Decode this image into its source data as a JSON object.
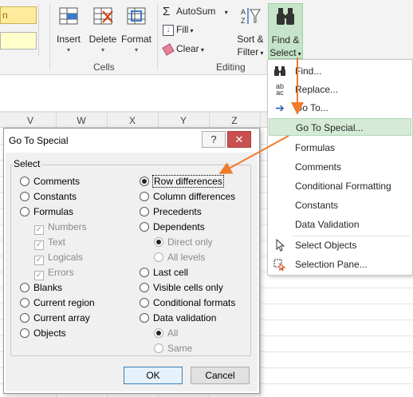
{
  "ribbon": {
    "cells_group": {
      "label": "Cells",
      "insert": "Insert",
      "delete": "Delete",
      "format": "Format"
    },
    "editing_group": {
      "label": "Editing",
      "autosum": "AutoSum",
      "fill": "Fill",
      "clear": "Clear",
      "sort_filter_1": "Sort &",
      "sort_filter_2": "Filter",
      "find_select_1": "Find &",
      "find_select_2": "Select"
    },
    "style_cell_text": "n"
  },
  "columns": [
    "V",
    "W",
    "X",
    "Y",
    "Z"
  ],
  "menu": {
    "items": [
      {
        "label": "Find...",
        "icon": "binoculars-icon"
      },
      {
        "label": "Replace...",
        "icon": "replace-icon"
      },
      {
        "label": "Go To...",
        "icon": "arrow-right-icon"
      },
      {
        "label": "Go To Special...",
        "icon": ""
      },
      {
        "label": "Formulas",
        "icon": ""
      },
      {
        "label": "Comments",
        "icon": ""
      },
      {
        "label": "Conditional Formatting",
        "icon": ""
      },
      {
        "label": "Constants",
        "icon": ""
      },
      {
        "label": "Data Validation",
        "icon": ""
      },
      {
        "label": "Select Objects",
        "icon": "pointer-icon"
      },
      {
        "label": "Selection Pane...",
        "icon": "selection-pane-icon"
      }
    ],
    "highlighted": "Go To Special..."
  },
  "dialog": {
    "title": "Go To Special",
    "help": "?",
    "close": "✕",
    "select_label": "Select",
    "left_options": [
      {
        "label": "Comments",
        "type": "radio",
        "checked": false,
        "enabled": true
      },
      {
        "label": "Constants",
        "type": "radio",
        "checked": false,
        "enabled": true
      },
      {
        "label": "Formulas",
        "type": "radio",
        "checked": false,
        "enabled": true
      },
      {
        "label": "Numbers",
        "type": "checkbox",
        "checked": true,
        "enabled": false
      },
      {
        "label": "Text",
        "type": "checkbox",
        "checked": true,
        "enabled": false
      },
      {
        "label": "Logicals",
        "type": "checkbox",
        "checked": true,
        "enabled": false
      },
      {
        "label": "Errors",
        "type": "checkbox",
        "checked": true,
        "enabled": false
      },
      {
        "label": "Blanks",
        "type": "radio",
        "checked": false,
        "enabled": true
      },
      {
        "label": "Current region",
        "type": "radio",
        "checked": false,
        "enabled": true
      },
      {
        "label": "Current array",
        "type": "radio",
        "checked": false,
        "enabled": true
      },
      {
        "label": "Objects",
        "type": "radio",
        "checked": false,
        "enabled": true
      }
    ],
    "right_options": [
      {
        "label": "Row differences",
        "type": "radio",
        "checked": true,
        "enabled": true
      },
      {
        "label": "Column differences",
        "type": "radio",
        "checked": false,
        "enabled": true
      },
      {
        "label": "Precedents",
        "type": "radio",
        "checked": false,
        "enabled": true
      },
      {
        "label": "Dependents",
        "type": "radio",
        "checked": false,
        "enabled": true
      },
      {
        "label": "Direct only",
        "type": "radio",
        "checked": true,
        "enabled": false
      },
      {
        "label": "All levels",
        "type": "radio",
        "checked": false,
        "enabled": false
      },
      {
        "label": "Last cell",
        "type": "radio",
        "checked": false,
        "enabled": true
      },
      {
        "label": "Visible cells only",
        "type": "radio",
        "checked": false,
        "enabled": true
      },
      {
        "label": "Conditional formats",
        "type": "radio",
        "checked": false,
        "enabled": true
      },
      {
        "label": "Data validation",
        "type": "radio",
        "checked": false,
        "enabled": true
      },
      {
        "label": "All",
        "type": "radio",
        "checked": true,
        "enabled": false
      },
      {
        "label": "Same",
        "type": "radio",
        "checked": false,
        "enabled": false
      }
    ],
    "ok": "OK",
    "cancel": "Cancel"
  },
  "colors": {
    "accent_green": "#d5ebd8",
    "arrow_orange": "#f07b2a",
    "find_select_bg": "#c6e4c9"
  }
}
